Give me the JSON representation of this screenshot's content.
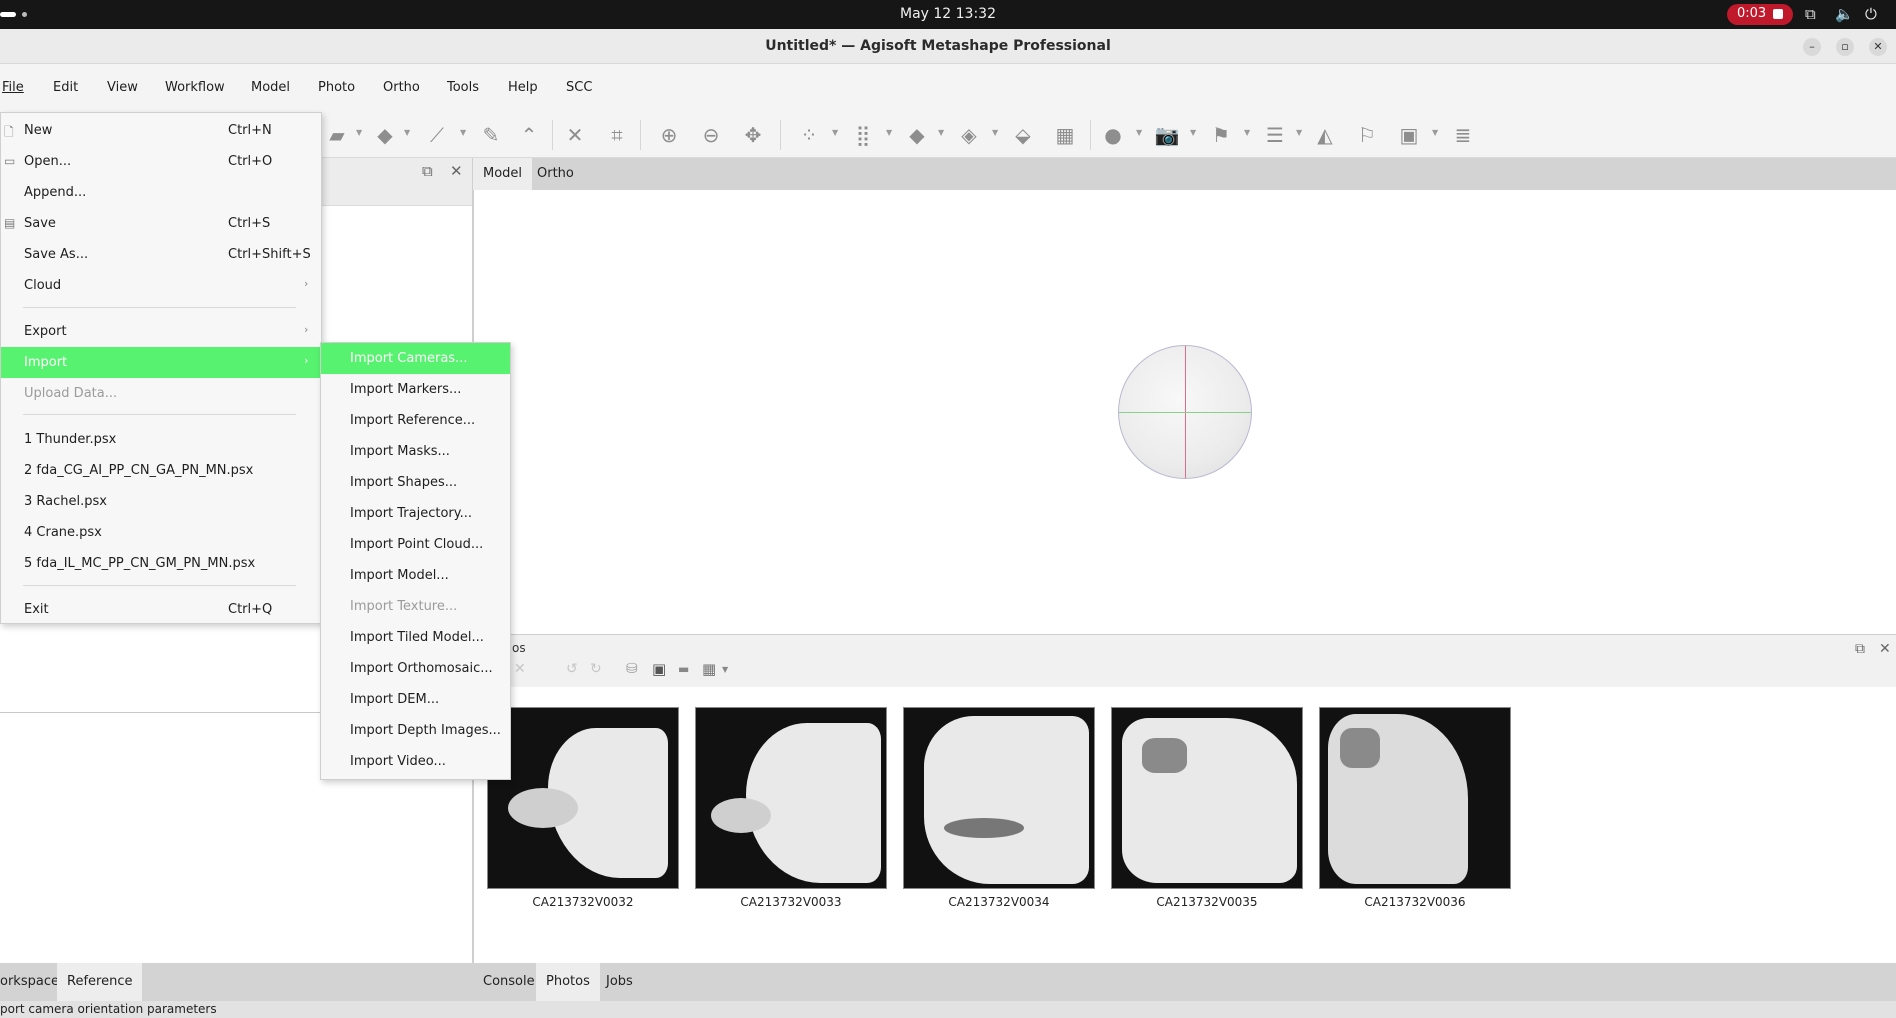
{
  "system_bar": {
    "clock": "May 12  13:32",
    "recording_time": "0:03",
    "tray_icons": [
      "network-icon",
      "volume-icon",
      "power-icon"
    ]
  },
  "window": {
    "title": "Untitled* — Agisoft Metashape Professional",
    "controls": [
      "minimize",
      "maximize",
      "close"
    ]
  },
  "menubar": {
    "items": [
      "File",
      "Edit",
      "View",
      "Workflow",
      "Model",
      "Photo",
      "Ortho",
      "Tools",
      "Help",
      "SCC"
    ]
  },
  "view_tabs": [
    "Model",
    "Ortho"
  ],
  "file_menu": {
    "items": [
      {
        "label": "New",
        "shortcut": "Ctrl+N",
        "icon": "new-file-icon"
      },
      {
        "label": "Open...",
        "shortcut": "Ctrl+O",
        "icon": "folder-icon"
      },
      {
        "label": "Append...",
        "shortcut": ""
      },
      {
        "label": "Save",
        "shortcut": "Ctrl+S",
        "icon": "save-icon"
      },
      {
        "label": "Save As...",
        "shortcut": "Ctrl+Shift+S"
      },
      {
        "label": "Cloud",
        "shortcut": "",
        "submenu": true
      },
      {
        "label": "Export",
        "shortcut": "",
        "submenu": true
      },
      {
        "label": "Import",
        "shortcut": "",
        "submenu": true,
        "highlighted": true
      },
      {
        "label": "Upload Data...",
        "shortcut": "",
        "disabled": true
      },
      {
        "label": "1 Thunder.psx",
        "shortcut": ""
      },
      {
        "label": "2 fda_CG_AI_PP_CN_GA_PN_MN.psx",
        "shortcut": ""
      },
      {
        "label": "3 Rachel.psx",
        "shortcut": ""
      },
      {
        "label": "4 Crane.psx",
        "shortcut": ""
      },
      {
        "label": "5 fda_IL_MC_PP_CN_GM_PN_MN.psx",
        "shortcut": ""
      },
      {
        "label": "Exit",
        "shortcut": "Ctrl+Q"
      }
    ]
  },
  "import_submenu": {
    "items": [
      {
        "label": "Import Cameras...",
        "highlighted": true
      },
      {
        "label": "Import Markers..."
      },
      {
        "label": "Import Reference..."
      },
      {
        "label": "Import Masks..."
      },
      {
        "label": "Import Shapes..."
      },
      {
        "label": "Import Trajectory..."
      },
      {
        "label": "Import Point Cloud..."
      },
      {
        "label": "Import Model..."
      },
      {
        "label": "Import Texture...",
        "disabled": true
      },
      {
        "label": "Import Tiled Model..."
      },
      {
        "label": "Import Orthomosaic..."
      },
      {
        "label": "Import DEM..."
      },
      {
        "label": "Import Depth Images..."
      },
      {
        "label": "Import Video..."
      }
    ]
  },
  "photos_pane": {
    "title_fragment": "os",
    "photos": [
      "CA213732V0032",
      "CA213732V0033",
      "CA213732V0034",
      "CA213732V0035",
      "CA213732V0036"
    ]
  },
  "bottom_tabs_left": [
    "orkspace",
    "Reference"
  ],
  "bottom_tabs_right": [
    "Console",
    "Photos",
    "Jobs"
  ],
  "status_text": "port camera orientation parameters",
  "colors": {
    "highlight": "#57f26f",
    "record": "#c0192b"
  }
}
